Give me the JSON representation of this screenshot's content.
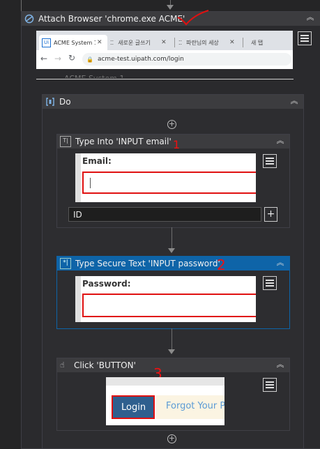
{
  "attach": {
    "title": "Attach Browser 'chrome.exe ACME'",
    "browser": {
      "tabs": [
        "ACME System 1",
        "새로운 글쓰기",
        "파란님의 세상",
        "새 탭"
      ],
      "url": "acme-test.uipath.com/login"
    },
    "partial_title": "ACME System 1"
  },
  "do": {
    "title": "Do"
  },
  "type_into": {
    "title": "Type Into 'INPUT  email'",
    "preview_label": "Email:",
    "text_value": "ID",
    "annotation": "1"
  },
  "type_secure": {
    "title": "Type Secure Text 'INPUT  password'",
    "preview_label": "Password:",
    "annotation": "2"
  },
  "click": {
    "title": "Click 'BUTTON'",
    "login_label": "Login",
    "forgot_label": "Forgot Your P",
    "annotation": "3"
  },
  "colors": {
    "selected_header": "#0e64a8",
    "annotation_red": "#e01010",
    "login_button": "#2f5f8e"
  }
}
